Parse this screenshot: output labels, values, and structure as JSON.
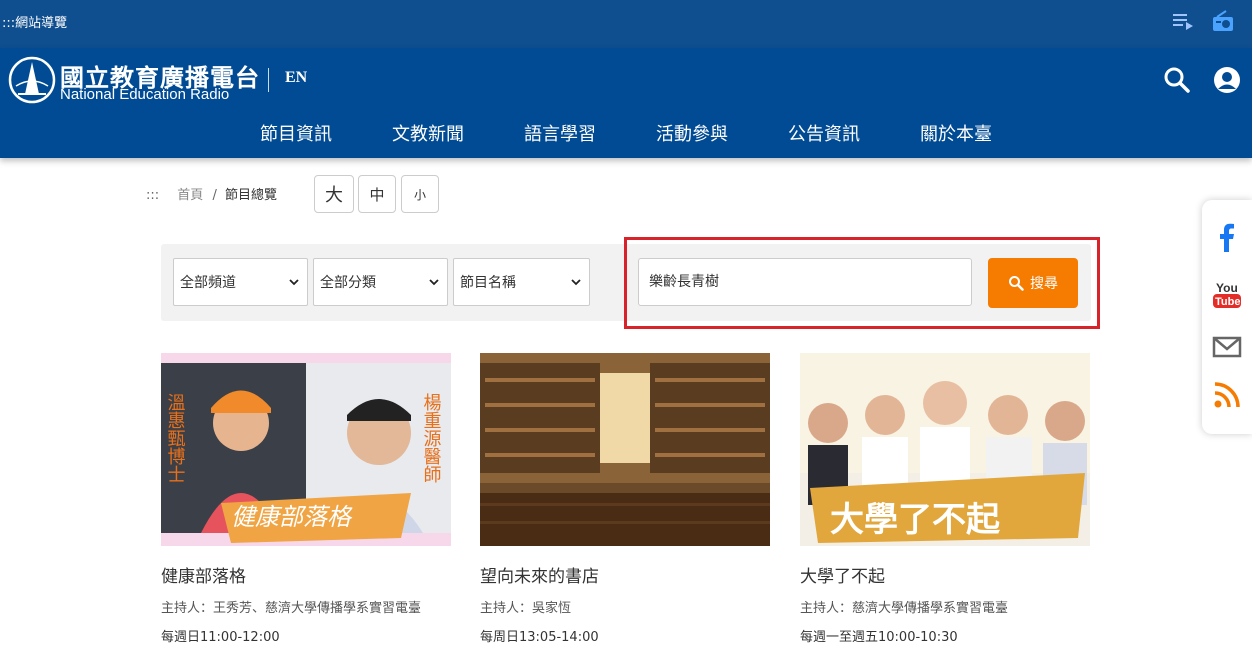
{
  "topbar": {
    "access_label": ":::網站導覽",
    "playlist_icon": "playlist-icon",
    "radio_icon": "radio-icon"
  },
  "header": {
    "logo_cn": "國立教育廣播電台",
    "logo_en": "National Education Radio",
    "lang": "EN",
    "search_icon": "search-icon",
    "user_icon": "user-icon"
  },
  "nav": {
    "items": [
      {
        "label": "節目資訊"
      },
      {
        "label": "文教新聞"
      },
      {
        "label": "語言學習"
      },
      {
        "label": "活動參與"
      },
      {
        "label": "公告資訊"
      },
      {
        "label": "關於本臺"
      }
    ]
  },
  "breadcrumb": {
    "marker": ":::",
    "home": "首頁",
    "sep": "/",
    "current": "節目總覽"
  },
  "font_size": {
    "large": "大",
    "medium": "中",
    "small": "小"
  },
  "filters": {
    "channel": "全部頻道",
    "category": "全部分類",
    "program_name": "節目名稱",
    "search_value": "樂齡長青樹",
    "search_button": "搜尋"
  },
  "cards": [
    {
      "title": "健康部落格",
      "host": "主持人：王秀芳、慈濟大學傳播學系實習電臺",
      "time": "每週日11:00-12:00",
      "image_text": {
        "left": "溫惠甄博士",
        "right": "楊重源醫師",
        "banner": "健康部落格"
      }
    },
    {
      "title": "望向未來的書店",
      "host": "主持人：吳家恆",
      "time": "每周日13:05-14:00"
    },
    {
      "title": "大學了不起",
      "host": "主持人：慈濟大學傳播學系實習電臺",
      "time": "每週一至週五10:00-10:30",
      "image_text": {
        "banner": "大學了不起"
      }
    }
  ],
  "social": [
    {
      "name": "facebook-icon",
      "color": "#1877f2"
    },
    {
      "name": "youtube-icon",
      "color": "#e52d27"
    },
    {
      "name": "mail-icon",
      "color": "#666666"
    },
    {
      "name": "rss-icon",
      "color": "#f57c00"
    }
  ],
  "colors": {
    "header": "#004b93",
    "topbar": "#0f4e8f",
    "accent": "#f57c00",
    "highlight": "#d8232a"
  }
}
